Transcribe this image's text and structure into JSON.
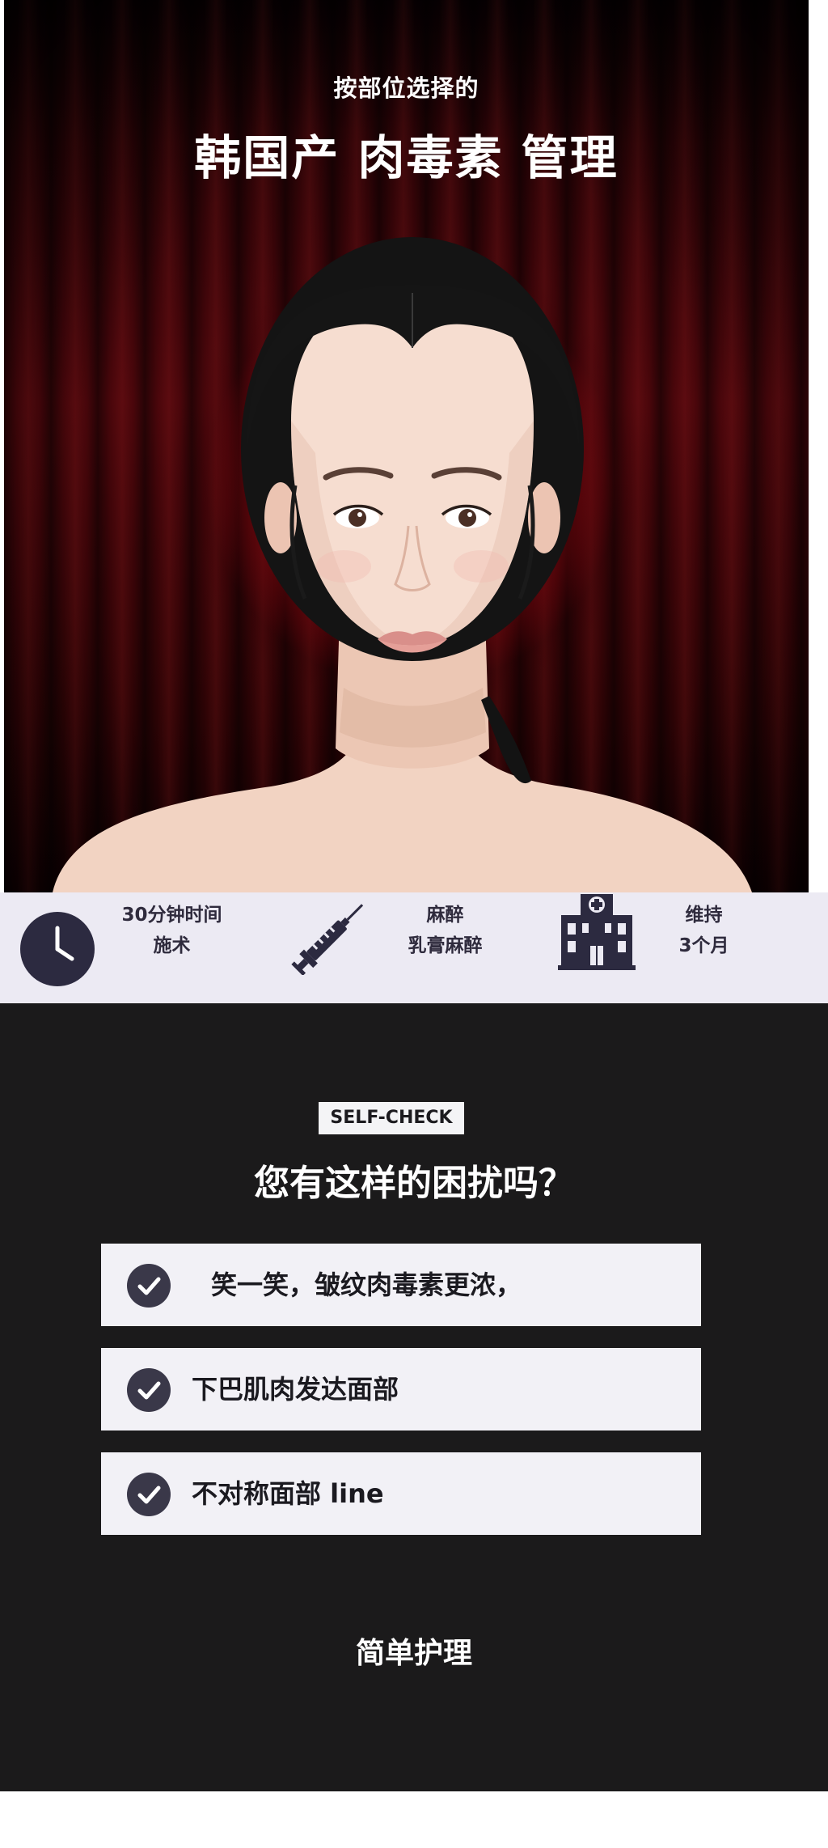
{
  "hero": {
    "subtitle": "按部位选择的",
    "title": "韩国产 肉毒素 管理",
    "image": "portrait-woman-red-curtain"
  },
  "features": [
    {
      "icon": "clock-icon",
      "line1": "30分钟时间",
      "line2": "施术"
    },
    {
      "icon": "syringe-icon",
      "line1": "麻醉",
      "line2": "乳膏麻醉"
    },
    {
      "icon": "hospital-icon",
      "line1": "维持",
      "line2": "3个月"
    }
  ],
  "self_check": {
    "badge": "SELF-CHECK",
    "question": "您有这样的困扰吗？",
    "items": [
      {
        "icon": "checkmark-icon",
        "label": "笑一笑，皱纹肉毒素更浓，"
      },
      {
        "icon": "checkmark-icon",
        "label": "下巴肌肉发达面部"
      },
      {
        "icon": "checkmark-icon",
        "label": "不对称面部 line"
      }
    ],
    "footer": "简单护理"
  },
  "colors": {
    "curtain_red": "#c4080f",
    "feature_bg": "#eceaf3",
    "icon_navy": "#2c2a40",
    "dark_bg": "#1b1a1b",
    "check_circle": "#3a3849"
  }
}
